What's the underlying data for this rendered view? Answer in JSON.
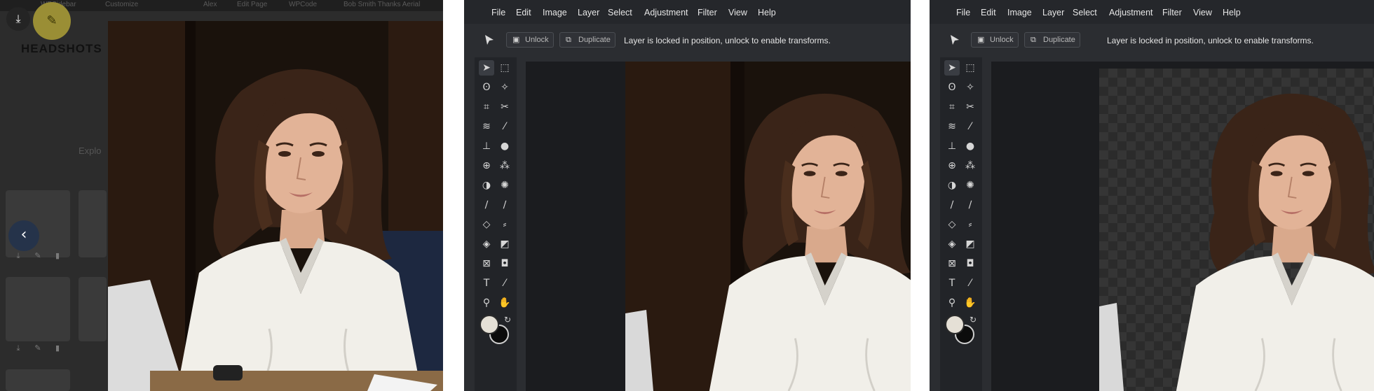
{
  "panel1": {
    "admin_bar": [
      "WPSidebar",
      "Customize",
      "Alex",
      "Edit Page",
      "WPCode",
      "Bob Smith Thanks Aerial"
    ],
    "brand_text": "HEADSHOTS",
    "explore_text": "Explo",
    "icons": {
      "download": "download-icon",
      "edit": "pencil-icon",
      "back": "chevron-left-icon"
    }
  },
  "editor": {
    "menu": [
      "File",
      "Edit",
      "Image",
      "Layer",
      "Select",
      "Adjustment",
      "Filter",
      "View",
      "Help"
    ],
    "unlock_label": "Unlock",
    "duplicate_label": "Duplicate",
    "message": "Layer is locked in position, unlock to enable transforms.",
    "foreground_color": "#e5e0d6",
    "background_color": "#0c0c0c",
    "tools": [
      "move-icon",
      "marquee-icon",
      "lasso-icon",
      "magic-wand-icon",
      "crop-icon",
      "scissors-icon",
      "wave-icon",
      "bandage-icon",
      "stamp-icon",
      "drop-icon",
      "globe-icon",
      "dots-icon",
      "contrast-icon",
      "sun-icon",
      "pencil-icon",
      "brush-icon",
      "eraser-icon",
      "smudge-icon",
      "bucket-icon",
      "gradient-icon",
      "shape-icon",
      "clone-icon",
      "text-icon",
      "eyedropper-icon",
      "zoom-icon",
      "hand-icon"
    ]
  }
}
